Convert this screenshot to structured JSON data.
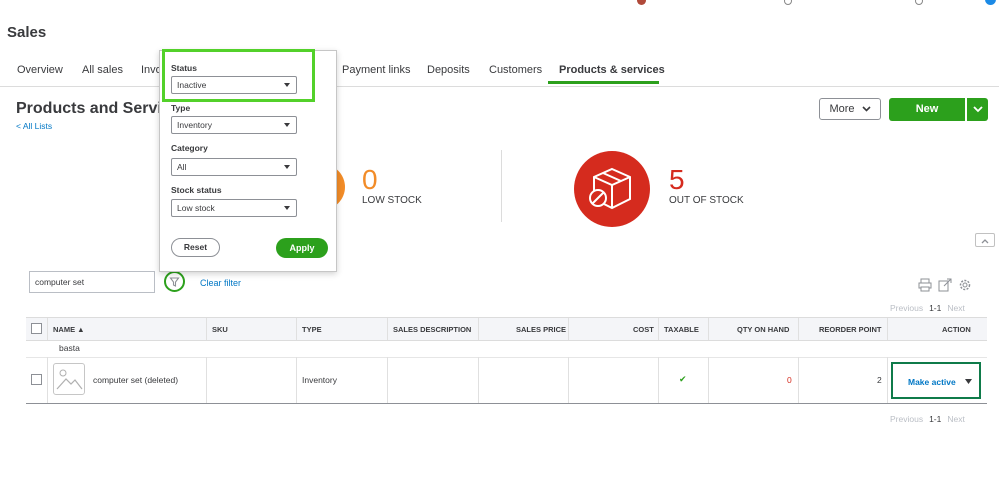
{
  "page": {
    "heading": "Sales"
  },
  "tabs": [
    {
      "label": "Overview"
    },
    {
      "label": "All sales"
    },
    {
      "label": "Invo"
    },
    {
      "label": "Payment links"
    },
    {
      "label": "Deposits"
    },
    {
      "label": "Customers"
    },
    {
      "label": "Products & services",
      "active": true
    }
  ],
  "header": {
    "title": "Products and Servic",
    "back_link": "< All Lists",
    "more_label": "More",
    "new_label": "New"
  },
  "stock_cards": {
    "low": {
      "count": "0",
      "label": "LOW STOCK"
    },
    "out": {
      "count": "5",
      "label": "OUT OF STOCK"
    }
  },
  "filter_bar": {
    "search_value": "computer set",
    "clear_filter": "Clear filter"
  },
  "filter_panel": {
    "status": {
      "label": "Status",
      "value": "Inactive"
    },
    "type": {
      "label": "Type",
      "value": "Inventory"
    },
    "category": {
      "label": "Category",
      "value": "All"
    },
    "stock_status": {
      "label": "Stock status",
      "value": "Low stock"
    },
    "reset_label": "Reset",
    "apply_label": "Apply"
  },
  "pager_top": {
    "prev": "Previous",
    "range": "1-1",
    "next": "Next"
  },
  "pager_bottom": {
    "prev": "Previous",
    "range": "1-1",
    "next": "Next"
  },
  "table": {
    "columns": [
      "NAME ▲",
      "SKU",
      "TYPE",
      "SALES DESCRIPTION",
      "SALES PRICE",
      "COST",
      "TAXABLE",
      "QTY ON HAND",
      "REORDER POINT",
      "ACTION"
    ],
    "group_label": "basta",
    "rows": [
      {
        "name": "computer set (deleted)",
        "sku": "",
        "type": "Inventory",
        "sales_description": "",
        "sales_price": "",
        "cost": "",
        "taxable": "✔",
        "qty_on_hand": "0",
        "reorder_point": "2",
        "action": "Make active"
      }
    ]
  },
  "colors": {
    "brand_green": "#2ca01c",
    "link_blue": "#0077c5",
    "alert_red": "#d52b1e",
    "highlight_green": "#53d12a",
    "action_outline": "#0f7b4a"
  },
  "icons": [
    "filter-icon",
    "print-icon",
    "export-icon",
    "settings-icon",
    "chevron-down-icon",
    "chevron-up-icon",
    "box-icon",
    "no-entry-icon",
    "image-placeholder-icon",
    "check-icon"
  ]
}
